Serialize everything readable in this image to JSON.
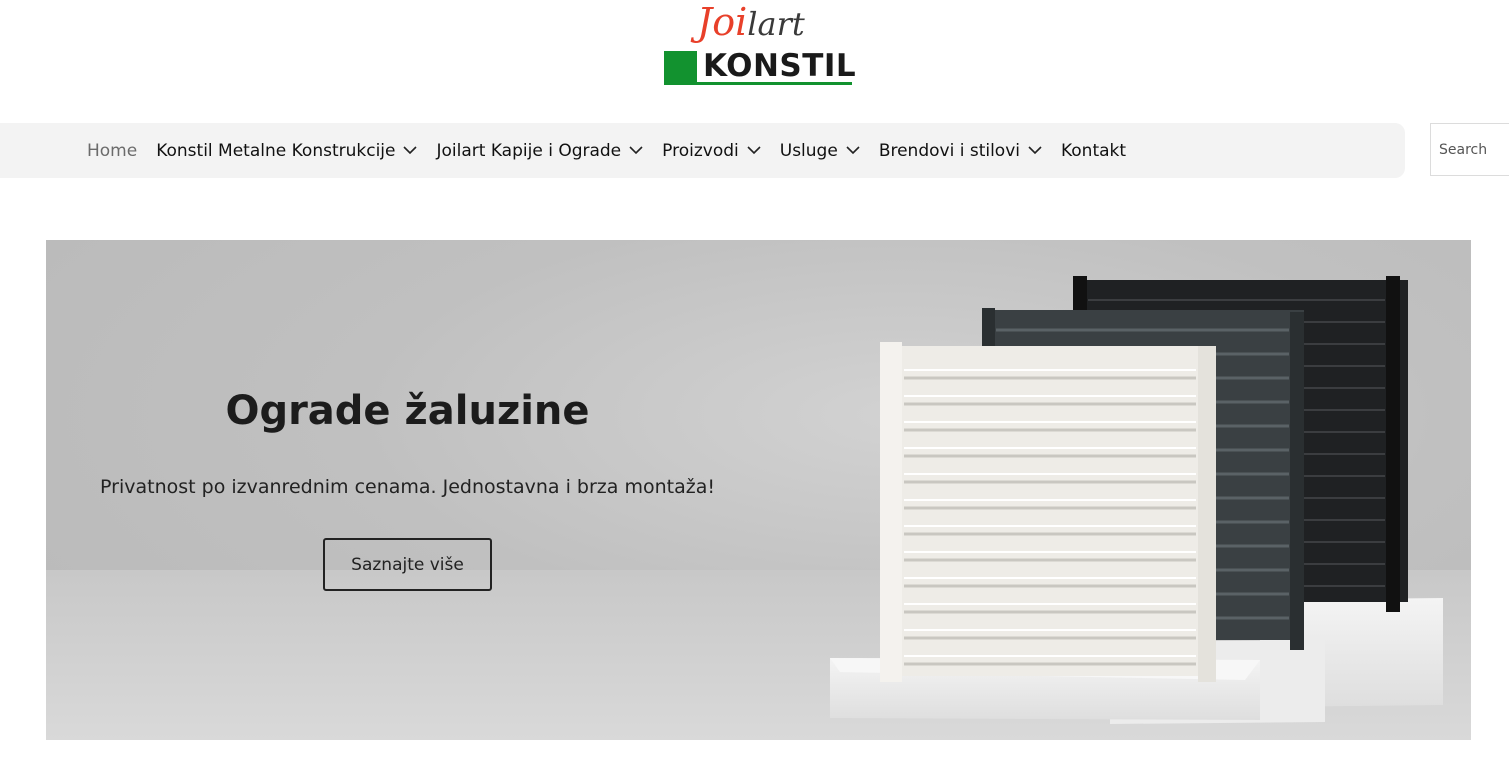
{
  "logo": {
    "jo": "Joi",
    "art": "lart",
    "brand": "KONSTIL",
    "colors": {
      "red": "#e8402a",
      "green": "#12922f"
    }
  },
  "nav": {
    "items": [
      {
        "label": "Home",
        "active": true,
        "dropdown": false
      },
      {
        "label": "Konstil Metalne Konstrukcije",
        "dropdown": true
      },
      {
        "label": "Joilart Kapije i Ograde",
        "dropdown": true
      },
      {
        "label": "Proizvodi",
        "dropdown": true
      },
      {
        "label": "Usluge",
        "dropdown": true
      },
      {
        "label": "Brendovi i stilovi",
        "dropdown": true
      },
      {
        "label": "Kontakt",
        "dropdown": false
      }
    ],
    "search_placeholder": "Search"
  },
  "hero": {
    "title": "Ograde žaluzine",
    "subtitle": "Privatnost po izvanrednim cenama. Jednostavna i brza montaža!",
    "button_label": "Saznajte više",
    "image": "louver-fence-panels-image"
  }
}
